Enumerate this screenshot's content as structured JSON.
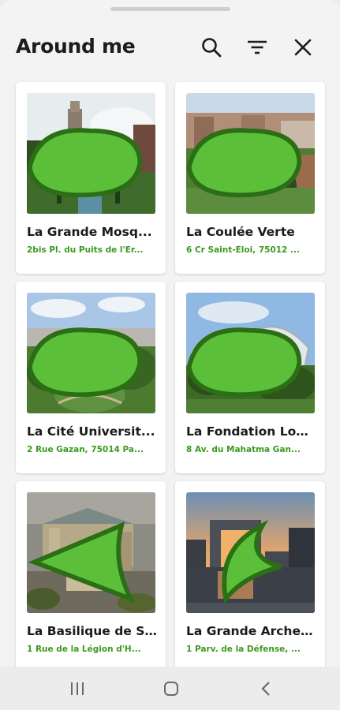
{
  "header": {
    "title": "Around me"
  },
  "icons": {
    "search": "search-icon",
    "filter": "filter-icon",
    "close": "close-icon",
    "badge": "green-leaf-badge-icon"
  },
  "colors": {
    "accent_green": "#3a9a1e",
    "badge_green": "#5cbf3a"
  },
  "places": [
    {
      "name": "La Grande Mosq...",
      "address": "2bis Pl. du Puits de l'Er..."
    },
    {
      "name": "La Coulée Verte",
      "address": "6 Cr Saint-Éloi, 75012 ..."
    },
    {
      "name": "La Cité Universit...",
      "address": "2 Rue Gazan, 75014 Pa..."
    },
    {
      "name": "La Fondation Lou...",
      "address": "8 Av. du Mahatma Gan..."
    },
    {
      "name": "La Basilique de S...",
      "address": "1 Rue de la Légion d'H..."
    },
    {
      "name": "La Grande Arche ...",
      "address": "1 Parv. de la Défense, ..."
    }
  ],
  "navbar": {
    "recents": "recents-icon",
    "home": "home-icon",
    "back": "back-icon"
  }
}
